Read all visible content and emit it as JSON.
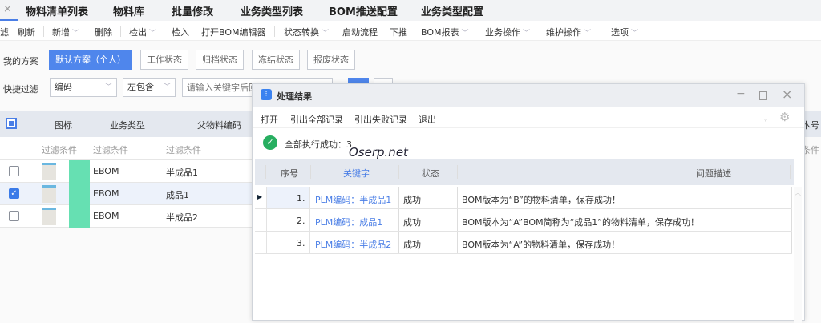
{
  "tabs": {
    "close": "×",
    "items": [
      "物料清单列表",
      "物料库",
      "批量修改",
      "业务类型列表",
      "BOM推送配置",
      "业务类型配置"
    ]
  },
  "toolbar": {
    "items": [
      "滤",
      "刷新",
      "新增",
      "删除",
      "检出",
      "检入",
      "打开BOM编辑器",
      "状态转换",
      "启动流程",
      "下推",
      "BOM报表",
      "业务操作",
      "维护操作",
      "选项"
    ]
  },
  "scheme": {
    "label": "我的方案",
    "buttons": [
      "默认方案（个人）",
      "工作状态",
      "归档状态",
      "冻结状态",
      "报废状态"
    ]
  },
  "quick_filter": {
    "label": "快捷过滤",
    "field": "编码",
    "op": "左包含",
    "placeholder": "请输入关键字后回车"
  },
  "grid": {
    "headers": [
      "图标",
      "业务类型",
      "父物料编码"
    ],
    "filter": "过滤条件",
    "rows": [
      {
        "type": "EBOM",
        "code": "半成品1",
        "checked": false
      },
      {
        "type": "EBOM",
        "code": "成品1",
        "checked": true
      },
      {
        "type": "EBOM",
        "code": "半成品2",
        "checked": false
      }
    ],
    "behind_header": "本号",
    "behind_filter": "条件"
  },
  "dialog": {
    "title": "处理结果",
    "menu": [
      "打开",
      "引出全部记录",
      "引出失败记录",
      "退出"
    ],
    "success": "全部执行成功：3",
    "watermark": "Oserp.net",
    "headers": [
      "序号",
      "关键字",
      "状态",
      "问题描述"
    ],
    "rows": [
      {
        "no": "1.",
        "key": "PLM编码：半成品1",
        "status": "成功",
        "desc": "BOM版本为“B”的物料清单，保存成功！"
      },
      {
        "no": "2.",
        "key": "PLM编码：成品1",
        "status": "成功",
        "desc": "BOM版本为“A”BOM简称为“成品1”的物料清单，保存成功！"
      },
      {
        "no": "3.",
        "key": "PLM编码：半成品2",
        "status": "成功",
        "desc": "BOM版本为“A”的物料清单，保存成功！"
      }
    ]
  },
  "colors": {
    "accent": "#4a7ee6",
    "success": "#27ae60",
    "header": "#e4e8ef"
  }
}
